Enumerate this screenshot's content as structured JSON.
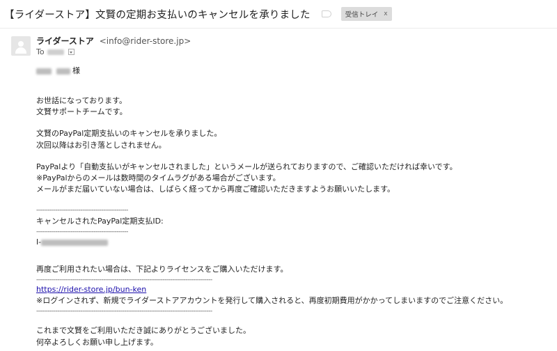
{
  "email": {
    "subject": "【ライダーストア】文賢の定期お支払いのキャンセルを承りました",
    "label": "受信トレイ",
    "label_close": "x",
    "sender_name": "ライダーストア",
    "sender_email": "<info@rider-store.jp>",
    "to_prefix": "To",
    "salutation_suffix": "様",
    "body": {
      "line1": "お世話になっております。",
      "line2": "文賢サポートチームです。",
      "line3": "文賢のPayPal定期支払いのキャンセルを承りました。",
      "line4": "次回以降はお引き落としされません。",
      "line5": "PayPalより「自動支払いがキャンセルされました」というメールが送られておりますので、ご確認いただければ幸いです。",
      "line6": "※PayPalからのメールは数時間のタイムラグがある場合がございます。",
      "line7": "メールがまだ届いていない場合は、しばらく経ってから再度ご確認いただきますようお願いいたします。",
      "divider_short": "------------------------------------------------",
      "cancel_id_label": "キャンセルされたPayPal定期支払ID:",
      "id_prefix": "I-",
      "line8": "再度ご利用されたい場合は、下記よりライセンスをご購入いただけます。",
      "divider_long": "--------------------------------------------------------------------------------------------",
      "link": "https://rider-store.jp/bun-ken",
      "line9": "※ログインされず、新規でライダーストアアカウントを発行して購入されると、再度初期費用がかかってしまいますのでご注意ください。",
      "line10": "これまで文賢をご利用いただき誠にありがとうございました。",
      "line11": "何卒よろしくお願い申し上げます。"
    }
  }
}
